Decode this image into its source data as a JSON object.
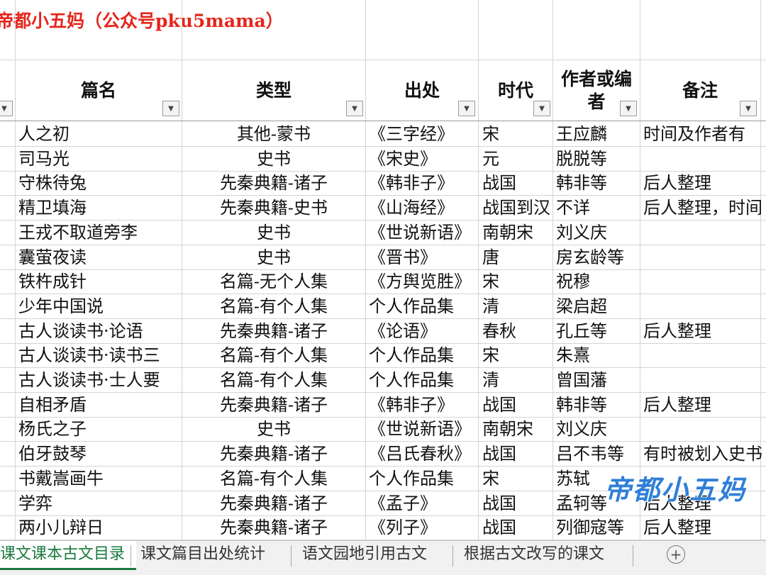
{
  "title": "帝都小五妈（公众号pku5mama）",
  "headers": {
    "name": "篇名",
    "type": "类型",
    "source": "出处",
    "era": "时代",
    "author": "作者或编者",
    "note": "备注"
  },
  "rows": [
    {
      "name": "人之初",
      "type": "其他-蒙书",
      "source": "《三字经》",
      "era": "宋",
      "author": "王应麟",
      "note": "时间及作者有"
    },
    {
      "name": "司马光",
      "type": "史书",
      "source": "《宋史》",
      "era": "元",
      "author": "脱脱等",
      "note": ""
    },
    {
      "name": "守株待兔",
      "type": "先秦典籍-诸子",
      "source": "《韩非子》",
      "era": "战国",
      "author": "韩非等",
      "note": "后人整理"
    },
    {
      "name": "精卫填海",
      "type": "先秦典籍-史书",
      "source": "《山海经》",
      "era": "战国到汉",
      "author": "不详",
      "note": "后人整理，时间"
    },
    {
      "name": "王戎不取道旁李",
      "type": "史书",
      "source": "《世说新语》",
      "era": "南朝宋",
      "author": "刘义庆",
      "note": ""
    },
    {
      "name": "囊萤夜读",
      "type": "史书",
      "source": "《晋书》",
      "era": "唐",
      "author": "房玄龄等",
      "note": ""
    },
    {
      "name": "铁杵成针",
      "type": "名篇-无个人集",
      "source": "《方舆览胜》",
      "era": "宋",
      "author": "祝穆",
      "note": ""
    },
    {
      "name": "少年中国说",
      "type": "名篇-有个人集",
      "source": "个人作品集",
      "era": "清",
      "author": "梁启超",
      "note": ""
    },
    {
      "name": "古人谈读书·论语",
      "type": "先秦典籍-诸子",
      "source": "《论语》",
      "era": "春秋",
      "author": "孔丘等",
      "note": "后人整理"
    },
    {
      "name": "古人谈读书·读书三",
      "type": "名篇-有个人集",
      "source": "个人作品集",
      "era": "宋",
      "author": "朱熹",
      "note": ""
    },
    {
      "name": "古人谈读书·士人要",
      "type": "名篇-有个人集",
      "source": "个人作品集",
      "era": "清",
      "author": "曾国藩",
      "note": ""
    },
    {
      "name": "自相矛盾",
      "type": "先秦典籍-诸子",
      "source": "《韩非子》",
      "era": "战国",
      "author": "韩非等",
      "note": "后人整理"
    },
    {
      "name": "杨氏之子",
      "type": "史书",
      "source": "《世说新语》",
      "era": "南朝宋",
      "author": "刘义庆",
      "note": ""
    },
    {
      "name": "伯牙鼓琴",
      "type": "先秦典籍-诸子",
      "source": "《吕氏春秋》",
      "era": "战国",
      "author": "吕不韦等",
      "note": "有时被划入史书"
    },
    {
      "name": "书戴嵩画牛",
      "type": "名篇-有个人集",
      "source": "个人作品集",
      "era": "宋",
      "author": "苏轼",
      "note": ""
    },
    {
      "name": "学弈",
      "type": "先秦典籍-诸子",
      "source": "《孟子》",
      "era": "战国",
      "author": "孟轲等",
      "note": "后人整理"
    },
    {
      "name": "两小儿辩日",
      "type": "先秦典籍-诸子",
      "source": "《列子》",
      "era": "战国",
      "author": "列御寇等",
      "note": "后人整理"
    }
  ],
  "tabs": [
    {
      "label": "课文课本古文目录",
      "active": true
    },
    {
      "label": "课文篇目出处统计",
      "active": false
    },
    {
      "label": "语文园地引用古文",
      "active": false
    },
    {
      "label": "根据古文改写的课文",
      "active": false
    }
  ],
  "add_sheet_label": "+",
  "filter_icon": "dropdown-arrow-icon",
  "watermark": "帝都小五妈",
  "colors": {
    "title": "#e4261c",
    "tab_active": "#1b7a3f",
    "watermark": "#2f7fd8"
  }
}
